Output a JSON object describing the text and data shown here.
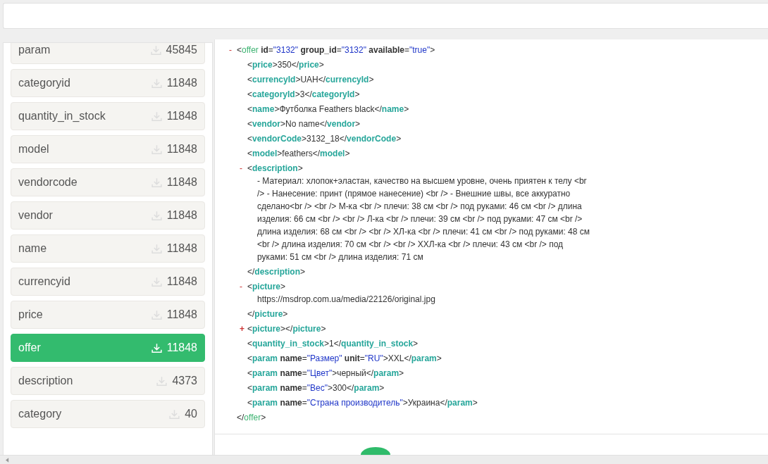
{
  "sidebar": {
    "items": [
      {
        "label": "param",
        "count": "45845",
        "selected": false
      },
      {
        "label": "categoryid",
        "count": "11848",
        "selected": false
      },
      {
        "label": "quantity_in_stock",
        "count": "11848",
        "selected": false
      },
      {
        "label": "model",
        "count": "11848",
        "selected": false
      },
      {
        "label": "vendorcode",
        "count": "11848",
        "selected": false
      },
      {
        "label": "vendor",
        "count": "11848",
        "selected": false
      },
      {
        "label": "name",
        "count": "11848",
        "selected": false
      },
      {
        "label": "currencyid",
        "count": "11848",
        "selected": false
      },
      {
        "label": "price",
        "count": "11848",
        "selected": false
      },
      {
        "label": "offer",
        "count": "11848",
        "selected": true
      },
      {
        "label": "description",
        "count": "4373",
        "selected": false
      },
      {
        "label": "category",
        "count": "40",
        "selected": false
      }
    ]
  },
  "xml": {
    "root": {
      "toggle": "-",
      "expanded": true,
      "open": [
        {
          "kind": "punct",
          "text": "<"
        },
        {
          "kind": "root",
          "text": "offer"
        },
        {
          "kind": "attr",
          "text": " id"
        },
        {
          "kind": "punct",
          "text": "="
        },
        {
          "kind": "value",
          "text": "\"3132\""
        },
        {
          "kind": "attr",
          "text": " group_id"
        },
        {
          "kind": "punct",
          "text": "="
        },
        {
          "kind": "value",
          "text": "\"3132\""
        },
        {
          "kind": "attr",
          "text": " available"
        },
        {
          "kind": "punct",
          "text": "="
        },
        {
          "kind": "value",
          "text": "\"true\""
        },
        {
          "kind": "punct",
          "text": ">"
        }
      ],
      "close": [
        {
          "kind": "punct",
          "text": "</"
        },
        {
          "kind": "root",
          "text": "offer"
        },
        {
          "kind": "punct",
          "text": ">"
        }
      ],
      "children": [
        {
          "open": [
            {
              "kind": "punct",
              "text": "<"
            },
            {
              "kind": "tag",
              "text": "price"
            },
            {
              "kind": "punct",
              "text": ">350</"
            },
            {
              "kind": "tag",
              "text": "price"
            },
            {
              "kind": "punct",
              "text": ">"
            }
          ]
        },
        {
          "open": [
            {
              "kind": "punct",
              "text": "<"
            },
            {
              "kind": "tag",
              "text": "currencyId"
            },
            {
              "kind": "punct",
              "text": ">UAH</"
            },
            {
              "kind": "tag",
              "text": "currencyId"
            },
            {
              "kind": "punct",
              "text": ">"
            }
          ]
        },
        {
          "open": [
            {
              "kind": "punct",
              "text": "<"
            },
            {
              "kind": "tag",
              "text": "categoryId"
            },
            {
              "kind": "punct",
              "text": ">3</"
            },
            {
              "kind": "tag",
              "text": "categoryId"
            },
            {
              "kind": "punct",
              "text": ">"
            }
          ]
        },
        {
          "open": [
            {
              "kind": "punct",
              "text": "<"
            },
            {
              "kind": "tag",
              "text": "name"
            },
            {
              "kind": "punct",
              "text": ">Футболка Feathers black</"
            },
            {
              "kind": "tag",
              "text": "name"
            },
            {
              "kind": "punct",
              "text": ">"
            }
          ]
        },
        {
          "open": [
            {
              "kind": "punct",
              "text": "<"
            },
            {
              "kind": "tag",
              "text": "vendor"
            },
            {
              "kind": "punct",
              "text": ">No name</"
            },
            {
              "kind": "tag",
              "text": "vendor"
            },
            {
              "kind": "punct",
              "text": ">"
            }
          ]
        },
        {
          "open": [
            {
              "kind": "punct",
              "text": "<"
            },
            {
              "kind": "tag",
              "text": "vendorCode"
            },
            {
              "kind": "punct",
              "text": ">3132_18</"
            },
            {
              "kind": "tag",
              "text": "vendorCode"
            },
            {
              "kind": "punct",
              "text": ">"
            }
          ]
        },
        {
          "open": [
            {
              "kind": "punct",
              "text": "<"
            },
            {
              "kind": "tag",
              "text": "model"
            },
            {
              "kind": "punct",
              "text": ">feathers</"
            },
            {
              "kind": "tag",
              "text": "model"
            },
            {
              "kind": "punct",
              "text": ">"
            }
          ]
        },
        {
          "toggle": "-",
          "expanded": true,
          "open": [
            {
              "kind": "punct",
              "text": "<"
            },
            {
              "kind": "tag",
              "text": "description"
            },
            {
              "kind": "punct",
              "text": ">"
            }
          ],
          "body": "- Материал: хлопок+эластан, качество на высшем уровне, очень приятен к телу <br /> - Нанесение: принт (прямое нанесение) <br /> - Внешние швы, все аккуратно сделано<br /> <br /> М-ка <br /> плечи: 38 см <br /> под руками: 46 см <br /> длина изделия: 66 см <br /> <br /> Л-ка <br /> плечи: 39 см <br /> под руками: 47 см <br /> длина изделия: 68 см <br /> <br /> ХЛ-ка <br /> плечи: 41 см <br /> под руками: 48 см <br /> длина изделия: 70 см <br /> <br /> ХХЛ-ка <br /> плечи: 43 см <br /> под руками: 51 см <br /> длина изделия: 71 см",
          "close": [
            {
              "kind": "punct",
              "text": "</"
            },
            {
              "kind": "tag",
              "text": "description"
            },
            {
              "kind": "punct",
              "text": ">"
            }
          ]
        },
        {
          "toggle": "-",
          "expanded": true,
          "open": [
            {
              "kind": "punct",
              "text": "<"
            },
            {
              "kind": "tag",
              "text": "picture"
            },
            {
              "kind": "punct",
              "text": ">"
            }
          ],
          "body": "https://msdrop.com.ua/media/22126/original.jpg",
          "close": [
            {
              "kind": "punct",
              "text": "</"
            },
            {
              "kind": "tag",
              "text": "picture"
            },
            {
              "kind": "punct",
              "text": ">"
            }
          ]
        },
        {
          "toggle": "+",
          "expanded": false,
          "open": [
            {
              "kind": "punct",
              "text": "<"
            },
            {
              "kind": "tag",
              "text": "picture"
            },
            {
              "kind": "punct",
              "text": "></"
            },
            {
              "kind": "tag",
              "text": "picture"
            },
            {
              "kind": "punct",
              "text": ">"
            }
          ]
        },
        {
          "open": [
            {
              "kind": "punct",
              "text": "<"
            },
            {
              "kind": "tag",
              "text": "quantity_in_stock"
            },
            {
              "kind": "punct",
              "text": ">1</"
            },
            {
              "kind": "tag",
              "text": "quantity_in_stock"
            },
            {
              "kind": "punct",
              "text": ">"
            }
          ]
        },
        {
          "open": [
            {
              "kind": "punct",
              "text": "<"
            },
            {
              "kind": "tag",
              "text": "param"
            },
            {
              "kind": "attr",
              "text": " name"
            },
            {
              "kind": "punct",
              "text": "="
            },
            {
              "kind": "value",
              "text": "\"Размер\""
            },
            {
              "kind": "attr",
              "text": " unit"
            },
            {
              "kind": "punct",
              "text": "="
            },
            {
              "kind": "value",
              "text": "\"RU\""
            },
            {
              "kind": "punct",
              "text": ">XXL</"
            },
            {
              "kind": "tag",
              "text": "param"
            },
            {
              "kind": "punct",
              "text": ">"
            }
          ]
        },
        {
          "open": [
            {
              "kind": "punct",
              "text": "<"
            },
            {
              "kind": "tag",
              "text": "param"
            },
            {
              "kind": "attr",
              "text": " name"
            },
            {
              "kind": "punct",
              "text": "="
            },
            {
              "kind": "value",
              "text": "\"Цвет\""
            },
            {
              "kind": "punct",
              "text": ">черный</"
            },
            {
              "kind": "tag",
              "text": "param"
            },
            {
              "kind": "punct",
              "text": ">"
            }
          ]
        },
        {
          "open": [
            {
              "kind": "punct",
              "text": "<"
            },
            {
              "kind": "tag",
              "text": "param"
            },
            {
              "kind": "attr",
              "text": " name"
            },
            {
              "kind": "punct",
              "text": "="
            },
            {
              "kind": "value",
              "text": "\"Вес\""
            },
            {
              "kind": "punct",
              "text": ">300</"
            },
            {
              "kind": "tag",
              "text": "param"
            },
            {
              "kind": "punct",
              "text": ">"
            }
          ]
        },
        {
          "open": [
            {
              "kind": "punct",
              "text": "<"
            },
            {
              "kind": "tag",
              "text": "param"
            },
            {
              "kind": "attr",
              "text": " name"
            },
            {
              "kind": "punct",
              "text": "="
            },
            {
              "kind": "value",
              "text": "\"Страна производитель\""
            },
            {
              "kind": "punct",
              "text": ">Украина</"
            },
            {
              "kind": "tag",
              "text": "param"
            },
            {
              "kind": "punct",
              "text": ">"
            }
          ]
        }
      ]
    }
  }
}
